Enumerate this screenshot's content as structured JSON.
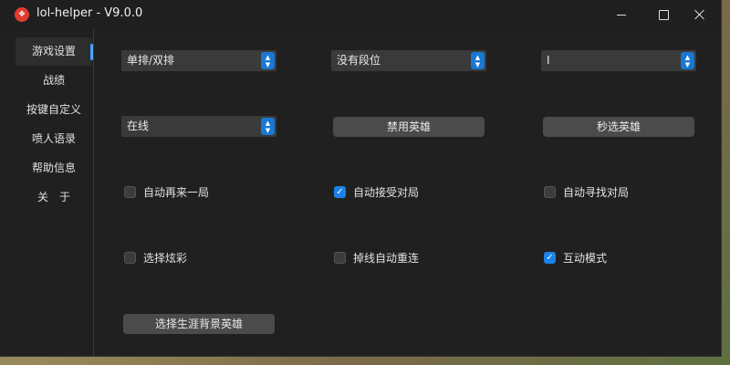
{
  "window": {
    "title": "lol-helper - V9.0.0",
    "app_icon_glyph": "❖"
  },
  "sidebar": {
    "items": [
      {
        "label": "游戏设置",
        "active": true
      },
      {
        "label": "战绩"
      },
      {
        "label": "按键自定义"
      },
      {
        "label": "喷人语录"
      },
      {
        "label": "帮助信息"
      },
      {
        "label": "关　于"
      }
    ]
  },
  "settings": {
    "queue_select": {
      "value": "单排/双排"
    },
    "rank_select": {
      "value": "没有段位"
    },
    "third_select": {
      "value": "I"
    },
    "status_select": {
      "value": "在线"
    },
    "ban_button": "禁用英雄",
    "instant_pick_button": "秒选英雄",
    "checkboxes": [
      {
        "label": "自动再来一局",
        "checked": false
      },
      {
        "label": "自动接受对局",
        "checked": true
      },
      {
        "label": "自动寻找对局",
        "checked": false
      },
      {
        "label": "选择炫彩",
        "checked": false
      },
      {
        "label": "掉线自动重连",
        "checked": false
      },
      {
        "label": "互动模式",
        "checked": true
      }
    ],
    "career_bg_button": "选择生涯背景英雄"
  },
  "colors": {
    "accent": "#1a82e8",
    "window_bg": "#202020",
    "control_bg": "#3a3a3a",
    "button_bg": "#4b4b4b"
  }
}
